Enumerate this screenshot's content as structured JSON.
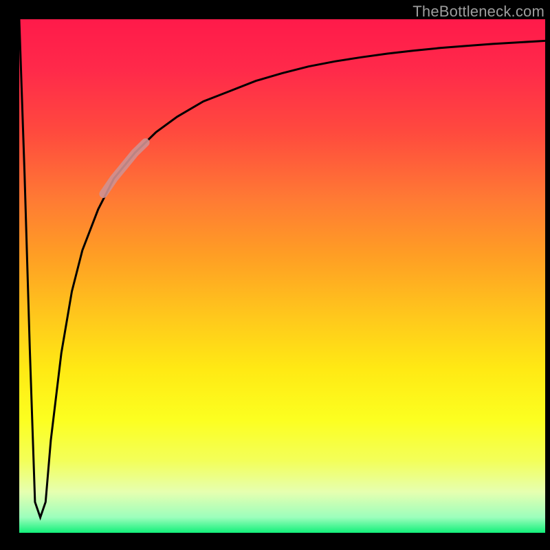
{
  "watermark": "TheBottleneck.com",
  "chart_data": {
    "type": "line",
    "title": "",
    "xlabel": "",
    "ylabel": "",
    "xlim": [
      0,
      100
    ],
    "ylim": [
      0,
      100
    ],
    "grid": false,
    "legend": false,
    "series": [
      {
        "name": "bottleneck-curve",
        "x": [
          0,
          1,
          2,
          3,
          4,
          5,
          6,
          8,
          10,
          12,
          15,
          18,
          22,
          26,
          30,
          35,
          40,
          45,
          50,
          55,
          60,
          65,
          70,
          75,
          80,
          85,
          90,
          95,
          100
        ],
        "y": [
          100,
          70,
          36,
          6,
          3,
          6,
          18,
          35,
          47,
          55,
          63,
          69,
          74,
          78,
          81,
          84,
          86,
          88,
          89.5,
          90.8,
          91.8,
          92.6,
          93.3,
          93.9,
          94.4,
          94.8,
          95.2,
          95.5,
          95.8
        ]
      },
      {
        "name": "highlight-segment",
        "x": [
          16,
          18,
          20,
          22,
          24
        ],
        "y": [
          66,
          69,
          71.5,
          74,
          76
        ]
      }
    ],
    "gradient_stops": [
      {
        "pos": 0,
        "color": "#ff1a4a"
      },
      {
        "pos": 22,
        "color": "#ff4a3e"
      },
      {
        "pos": 46,
        "color": "#ff9e24"
      },
      {
        "pos": 68,
        "color": "#ffe914"
      },
      {
        "pos": 92,
        "color": "#e6ffb0"
      },
      {
        "pos": 100,
        "color": "#12f07a"
      }
    ]
  }
}
